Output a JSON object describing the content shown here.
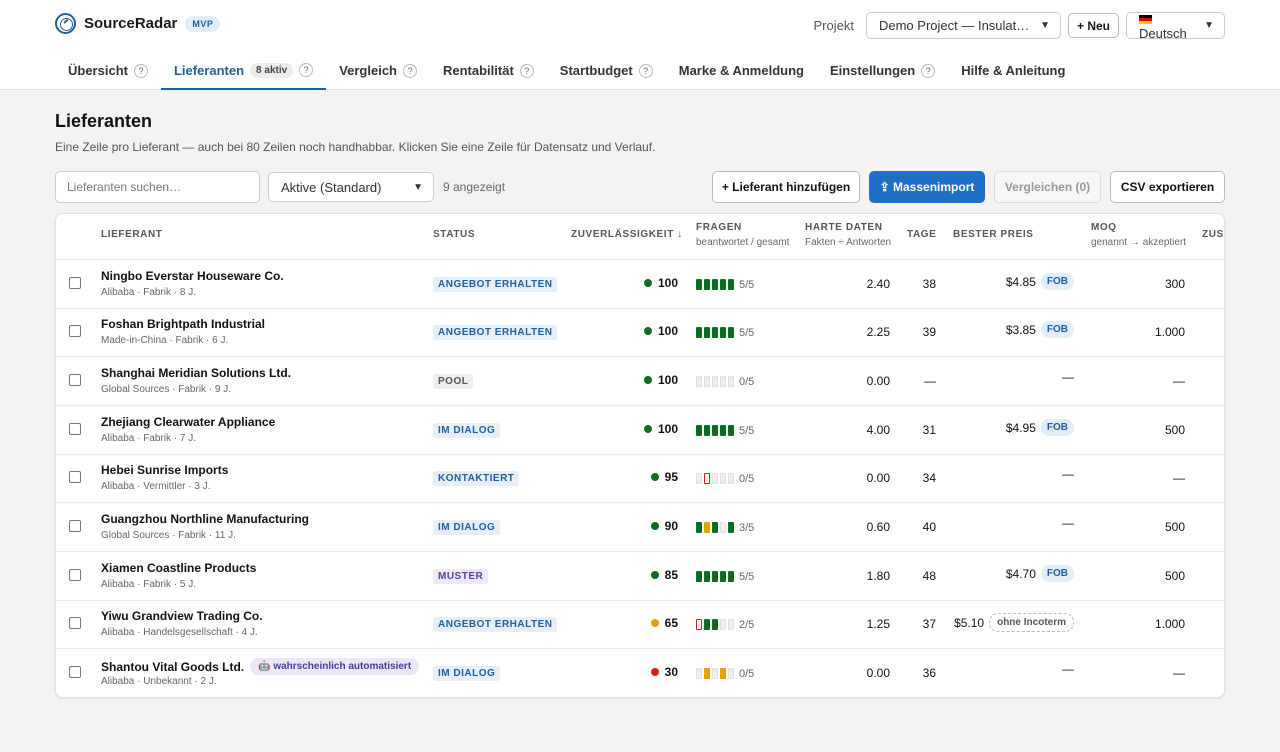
{
  "app": {
    "name": "SourceRadar",
    "badge": "MVP",
    "project_label": "Projekt",
    "project_value": "Demo Project — Insulated S…",
    "new_button": "+ Neu",
    "language": "Deutsch"
  },
  "tabs": [
    {
      "label": "Übersicht",
      "help": "?",
      "active": false
    },
    {
      "label": "Lieferanten",
      "count": "8 aktiv",
      "help": "?",
      "active": true
    },
    {
      "label": "Vergleich",
      "help": "?",
      "active": false
    },
    {
      "label": "Rentabilität",
      "help": "?",
      "active": false
    },
    {
      "label": "Startbudget",
      "help": "?",
      "active": false
    },
    {
      "label": "Marke & Anmeldung",
      "active": false
    },
    {
      "label": "Einstellungen",
      "help": "?",
      "active": false
    },
    {
      "label": "Hilfe & Anleitung",
      "active": false
    }
  ],
  "page": {
    "title": "Lieferanten",
    "subtitle": "Eine Zeile pro Lieferant — auch bei 80 Zeilen noch handhabbar. Klicken Sie eine Zeile für Datensatz und Verlauf."
  },
  "toolbar": {
    "search_placeholder": "Lieferanten suchen…",
    "filter_value": "Aktive (Standard)",
    "shown_count": "9 angezeigt",
    "add_label": "+ Lieferant hinzufügen",
    "import_label": "⇪ Massenimport",
    "compare_label": "Vergleichen (0)",
    "csv_label": "CSV exportieren"
  },
  "columns": {
    "supplier": "LIEFERANT",
    "status": "STATUS",
    "reliability": "ZUVERLÄSSIGKEIT ↓",
    "questions": "FRAGEN",
    "questions_sub": "beantwortet / gesamt",
    "hard": "HARTE DATEN",
    "hard_sub": "Fakten ÷ Antworten",
    "days": "TAGE",
    "price": "BESTER PREIS",
    "moq": "MOQ",
    "moq_sub": "genannt → akzeptiert",
    "extra": "ZUSA"
  },
  "colors": {
    "green": "#0f6b1f",
    "yellow": "#e0a400",
    "red": "#cc2222",
    "accent": "#1f6fc5"
  },
  "rows": [
    {
      "name": "Ningbo Everstar Houseware Co.",
      "meta": "Alibaba · Fabrik · 8 J.",
      "status": "ANGEBOT ERHALTEN",
      "status_kind": "angebot",
      "score": "100",
      "score_color": "#0f6b1f",
      "segments": [
        "g",
        "g",
        "g",
        "g",
        "g"
      ],
      "answered": "5/5",
      "hard": "2.40",
      "days": "38",
      "price": "$4.85",
      "incoterm": "FOB",
      "incoterm_kind": "fob",
      "moq": "300"
    },
    {
      "name": "Foshan Brightpath Industrial",
      "meta": "Made-in-China · Fabrik · 6 J.",
      "status": "ANGEBOT ERHALTEN",
      "status_kind": "angebot",
      "score": "100",
      "score_color": "#0f6b1f",
      "segments": [
        "g",
        "g",
        "g",
        "g",
        "g"
      ],
      "answered": "5/5",
      "hard": "2.25",
      "days": "39",
      "price": "$3.85",
      "incoterm": "FOB",
      "incoterm_kind": "fob",
      "moq": "1.000"
    },
    {
      "name": "Shanghai Meridian Solutions Ltd.",
      "meta": "Global Sources · Fabrik · 9 J.",
      "status": "POOL",
      "status_kind": "pool",
      "score": "100",
      "score_color": "#0f6b1f",
      "segments": [
        "e",
        "e",
        "e",
        "e",
        "e"
      ],
      "answered": "0/5",
      "hard": "0.00",
      "days": "—",
      "price": "—",
      "incoterm": "",
      "incoterm_kind": "",
      "moq": "—"
    },
    {
      "name": "Zhejiang Clearwater Appliance",
      "meta": "Alibaba · Fabrik · 7 J.",
      "status": "IM DIALOG",
      "status_kind": "dialog",
      "score": "100",
      "score_color": "#0f6b1f",
      "segments": [
        "g",
        "g",
        "g",
        "g",
        "g"
      ],
      "answered": "5/5",
      "hard": "4.00",
      "days": "31",
      "price": "$4.95",
      "incoterm": "FOB",
      "incoterm_kind": "fob",
      "moq": "500"
    },
    {
      "name": "Hebei Sunrise Imports",
      "meta": "Alibaba · Vermittler · 3 J.",
      "status": "KONTAKTIERT",
      "status_kind": "kontakt",
      "score": "95",
      "score_color": "#0f6b1f",
      "segments": [
        "e",
        "r",
        "e",
        "e",
        "e"
      ],
      "answered": "0/5",
      "hard": "0.00",
      "days": "34",
      "price": "—",
      "incoterm": "",
      "incoterm_kind": "",
      "moq": "—"
    },
    {
      "name": "Guangzhou Northline Manufacturing",
      "meta": "Global Sources · Fabrik · 11 J.",
      "status": "IM DIALOG",
      "status_kind": "dialog",
      "score": "90",
      "score_color": "#0f6b1f",
      "segments": [
        "g",
        "y",
        "g",
        "e",
        "g"
      ],
      "answered": "3/5",
      "hard": "0.60",
      "days": "40",
      "price": "—",
      "incoterm": "",
      "incoterm_kind": "",
      "moq": "500"
    },
    {
      "name": "Xiamen Coastline Products",
      "meta": "Alibaba · Fabrik · 5 J.",
      "status": "MUSTER",
      "status_kind": "muster",
      "score": "85",
      "score_color": "#0f6b1f",
      "segments": [
        "g",
        "g",
        "g",
        "g",
        "g"
      ],
      "answered": "5/5",
      "hard": "1.80",
      "days": "48",
      "price": "$4.70",
      "incoterm": "FOB",
      "incoterm_kind": "fob",
      "moq": "500"
    },
    {
      "name": "Yiwu Grandview Trading Co.",
      "meta": "Alibaba · Handelsgesellschaft · 4 J.",
      "status": "ANGEBOT ERHALTEN",
      "status_kind": "angebot",
      "score": "65",
      "score_color": "#e0a400",
      "segments": [
        "r",
        "g",
        "g",
        "e",
        "e"
      ],
      "answered": "2/5",
      "hard": "1.25",
      "days": "37",
      "price": "$5.10",
      "incoterm": "ohne Incoterm",
      "incoterm_kind": "none",
      "moq": "1.000"
    },
    {
      "name": "Shantou Vital Goods Ltd.",
      "badge": "🤖 wahrscheinlich automatisiert",
      "meta": "Alibaba · Unbekannt · 2 J.",
      "status": "IM DIALOG",
      "status_kind": "dialog",
      "score": "30",
      "score_color": "#cc2222",
      "segments": [
        "e",
        "y",
        "e",
        "y",
        "e"
      ],
      "answered": "0/5",
      "hard": "0.00",
      "days": "36",
      "price": "—",
      "incoterm": "",
      "incoterm_kind": "",
      "moq": "—"
    }
  ]
}
